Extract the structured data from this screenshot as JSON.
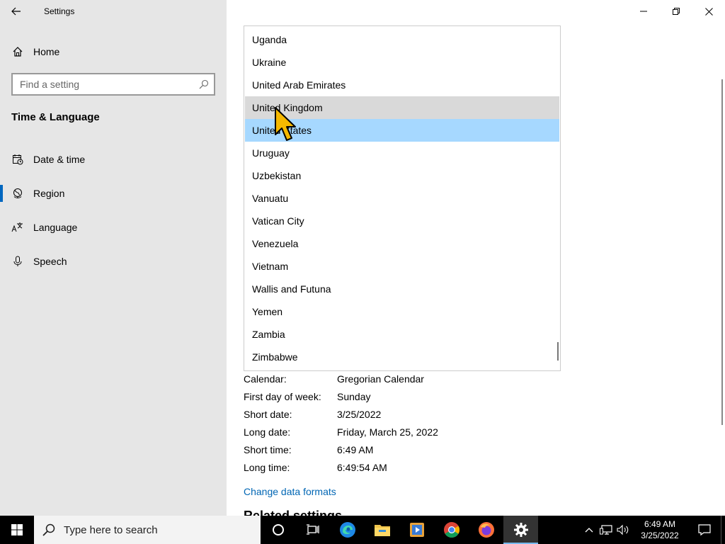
{
  "window": {
    "title": "Settings"
  },
  "sidebar": {
    "home_label": "Home",
    "search_placeholder": "Find a setting",
    "section_title": "Time & Language",
    "items": [
      {
        "label": "Date & time",
        "icon": "calendar-clock-icon"
      },
      {
        "label": "Region",
        "icon": "globe-icon",
        "active": true
      },
      {
        "label": "Language",
        "icon": "language-icon"
      },
      {
        "label": "Speech",
        "icon": "microphone-icon"
      }
    ]
  },
  "dropdown": {
    "items": [
      "Uganda",
      "Ukraine",
      "United Arab Emirates",
      "United Kingdom",
      "United States",
      "Uruguay",
      "Uzbekistan",
      "Vanuatu",
      "Vatican City",
      "Venezuela",
      "Vietnam",
      "Wallis and Futuna",
      "Yemen",
      "Zambia",
      "Zimbabwe"
    ],
    "hovered": "United Kingdom",
    "selected": "United States"
  },
  "formats": [
    {
      "key": "Calendar:",
      "value": "Gregorian Calendar"
    },
    {
      "key": "First day of week:",
      "value": "Sunday"
    },
    {
      "key": "Short date:",
      "value": "3/25/2022"
    },
    {
      "key": "Long date:",
      "value": "Friday, March 25, 2022"
    },
    {
      "key": "Short time:",
      "value": "6:49 AM"
    },
    {
      "key": "Long time:",
      "value": "6:49:54 AM"
    }
  ],
  "change_formats_link": "Change data formats",
  "related_settings_title": "Related settings",
  "taskbar": {
    "search_placeholder": "Type here to search",
    "time": "6:49 AM",
    "date": "3/25/2022"
  },
  "colors": {
    "accent": "#0067c0",
    "selected_bg": "#a6d8ff",
    "hover_bg": "#d9d9d9",
    "link": "#0066b4"
  }
}
